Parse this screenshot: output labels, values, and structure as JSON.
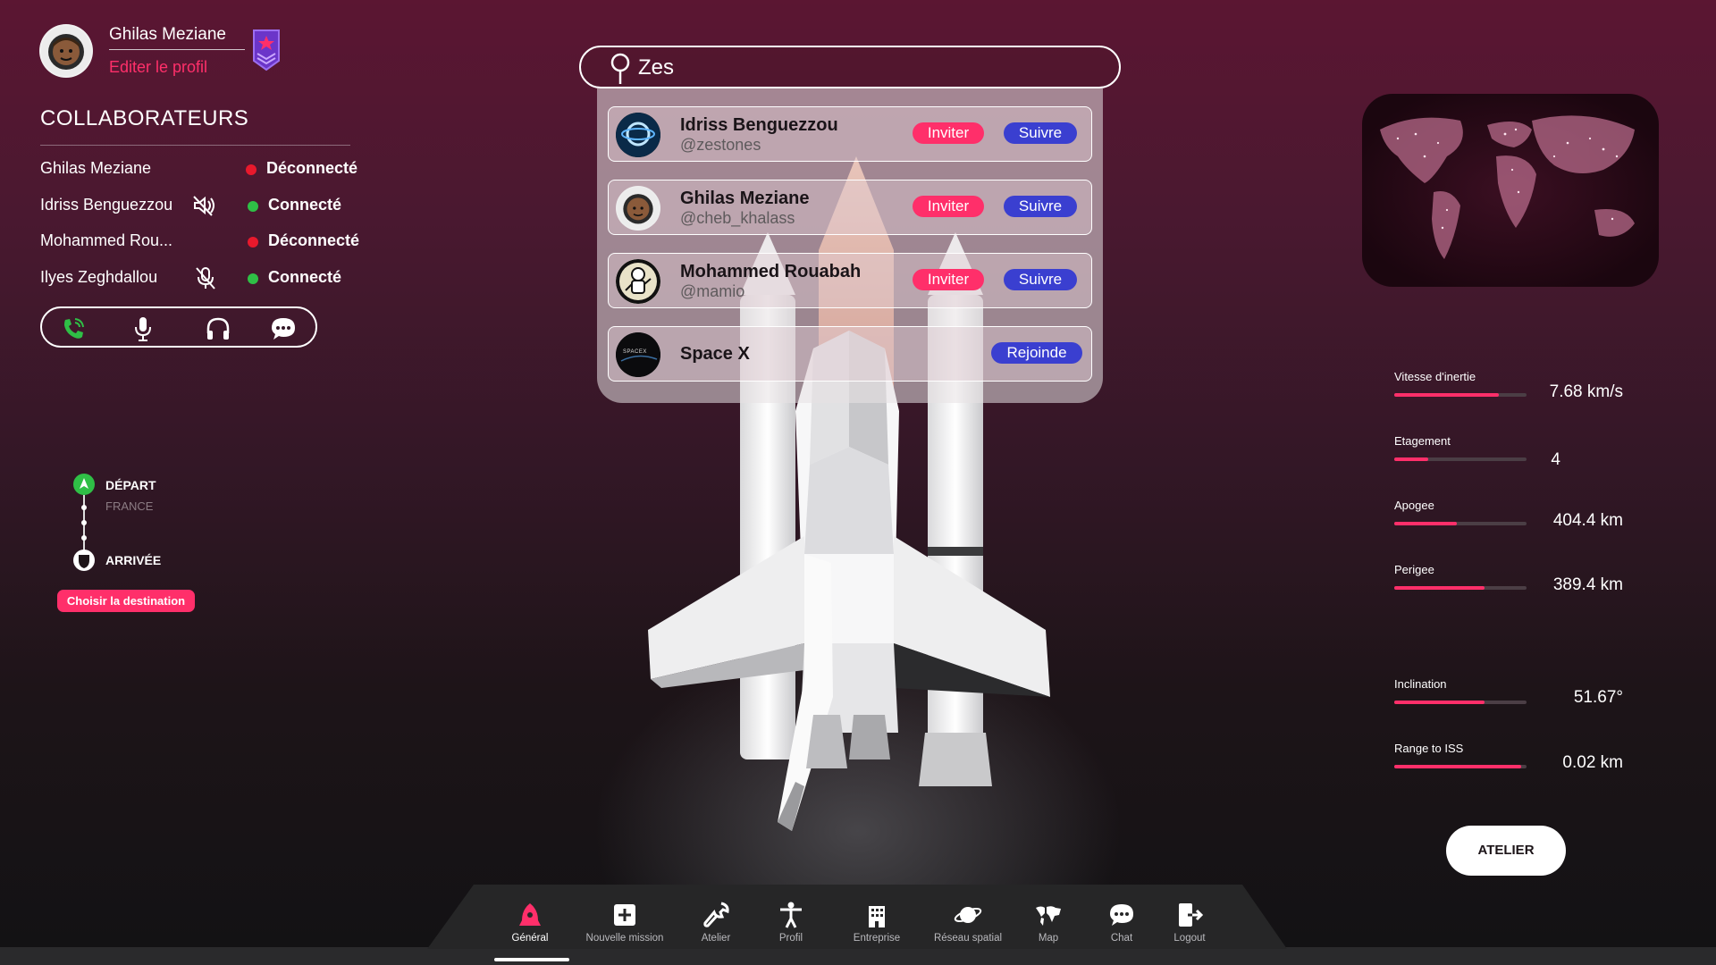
{
  "profile": {
    "name": "Ghilas Meziane",
    "edit_label": "Editer le profil"
  },
  "collaborators": {
    "title": "COLLABORATEURS",
    "items": [
      {
        "name": "Ghilas Meziane",
        "status": "Déconnecté",
        "status_color": "#e8192c",
        "icon": ""
      },
      {
        "name": "Idriss Benguezzou",
        "status": "Connecté",
        "status_color": "#2fbf46",
        "icon": "speaker-muted-icon"
      },
      {
        "name": "Mohammed Rou...",
        "status": "Déconnecté",
        "status_color": "#e8192c",
        "icon": ""
      },
      {
        "name": "Ilyes Zeghdallou",
        "status": "Connecté",
        "status_color": "#2fbf46",
        "icon": "microphone-muted-icon"
      }
    ]
  },
  "call_bar": {
    "icons": [
      "phone-call-icon",
      "microphone-icon",
      "headphones-icon",
      "chat-bubble-icon"
    ]
  },
  "route": {
    "departure_label": "DÉPART",
    "departure_place": "FRANCE",
    "arrival_label": "ARRIVÉE",
    "choose_label": "Choisir la destination"
  },
  "search": {
    "value": "Zes"
  },
  "results": [
    {
      "name": "Idriss Benguezzou",
      "handle": "@zestones",
      "invite": "Inviter",
      "follow": "Suivre"
    },
    {
      "name": "Ghilas Meziane",
      "handle": "@cheb_khalass",
      "invite": "Inviter",
      "follow": "Suivre"
    },
    {
      "name": "Mohammed Rouabah",
      "handle": "@mamio",
      "invite": "Inviter",
      "follow": "Suivre"
    },
    {
      "name": "Space X",
      "handle": "",
      "join": "Rejoinde",
      "logo_text": "SPACEX"
    }
  ],
  "stats": [
    {
      "label": "Vitesse d'inertie",
      "value": "7.68 km/s",
      "fill": 0.79
    },
    {
      "label": "Etagement",
      "value": "4",
      "fill": 0.26
    },
    {
      "label": "Apogee",
      "value": "404.4 km",
      "fill": 0.47
    },
    {
      "label": "Perigee",
      "value": "389.4 km",
      "fill": 0.68
    },
    {
      "label": "Inclination",
      "value": "51.67°",
      "fill": 0.68
    },
    {
      "label": "Range to ISS",
      "value": "0.02 km",
      "fill": 0.96
    }
  ],
  "atelier_button": "ATELIER",
  "nav": [
    {
      "label": "Général",
      "icon": "rocket-icon",
      "active": true
    },
    {
      "label": "Nouvelle mission",
      "icon": "plus-square-icon"
    },
    {
      "label": "Atelier",
      "icon": "wrench-icon"
    },
    {
      "label": "Profil",
      "icon": "person-icon"
    },
    {
      "label": "Entreprise",
      "icon": "building-icon"
    },
    {
      "label": "Réseau spatial",
      "icon": "planet-icon"
    },
    {
      "label": "Map",
      "icon": "world-map-icon"
    },
    {
      "label": "Chat",
      "icon": "chat-icon"
    },
    {
      "label": "Logout",
      "icon": "logout-icon"
    }
  ],
  "colors": {
    "accent": "#ff2f6a",
    "follow": "#3a3fd0",
    "connected": "#2fbf46",
    "disconnected": "#e8192c"
  }
}
